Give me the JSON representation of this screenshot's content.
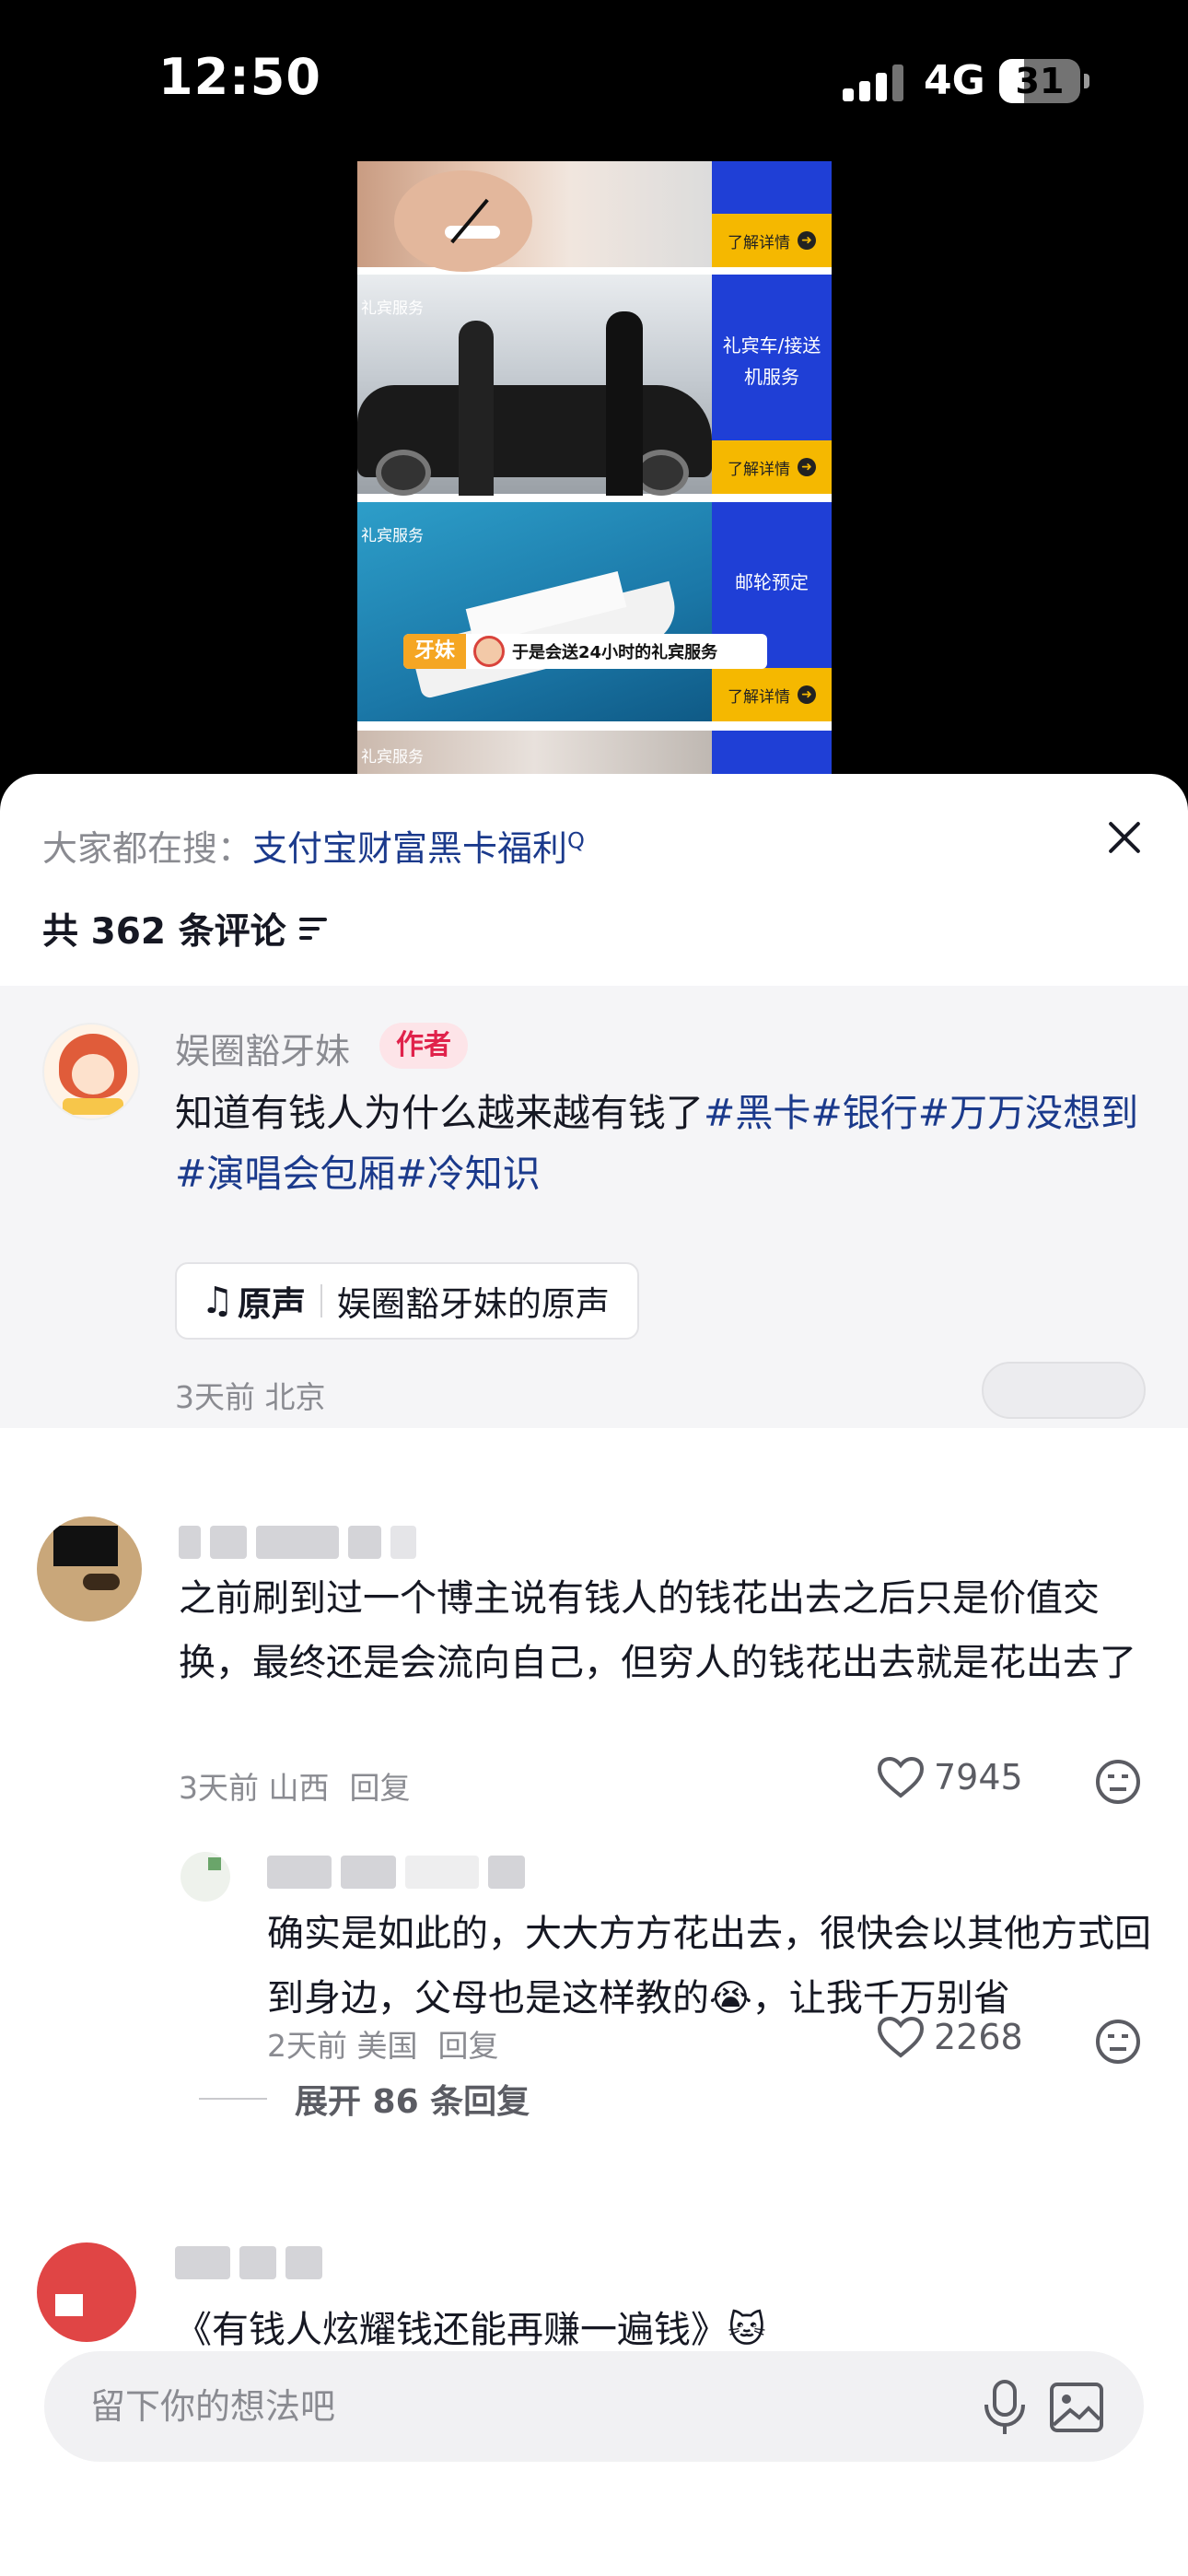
{
  "status_bar": {
    "time": "12:50",
    "network": "4G",
    "battery": "31",
    "battery_level": 0.31
  },
  "video": {
    "rows": [
      {
        "tag": "",
        "side_label": "",
        "button": "了解详情"
      },
      {
        "tag": "礼宾服务",
        "side_label": "礼宾车/接送机服务",
        "button": "了解详情"
      },
      {
        "tag": "礼宾服务",
        "side_label": "邮轮预定",
        "button": "了解详情"
      },
      {
        "tag": "礼宾服务",
        "side_label": "",
        "button": ""
      }
    ],
    "banner_brand": "牙妹",
    "banner_text": "于是会送24小时的礼宾服务",
    "arrow": "➜"
  },
  "sheet": {
    "search_prefix": "大家都在搜：",
    "search_term": "支付宝财富黑卡福利",
    "search_mark": "Q",
    "comment_count": "共 362 条评论"
  },
  "author_post": {
    "name": "娱圈豁牙妹",
    "badge": "作者",
    "text": "知道有钱人为什么越来越有钱了",
    "hashtags": [
      "#黑卡",
      "#银行",
      "#万万没想到",
      "#演唱会包厢",
      "#冷知识"
    ],
    "music_label": "原声",
    "music_title": "娱圈豁牙妹的原声",
    "meta": "3天前 北京",
    "note_glyph": "♫"
  },
  "comments": [
    {
      "text": "之前刷到过一个博主说有钱人的钱花出去之后只是价值交换，最终还是会流向自己，但穷人的钱花出去就是花出去了",
      "meta": "3天前 山西",
      "reply": "回复",
      "likes": "7945"
    },
    {
      "text": "确实是如此的，大大方方花出去，很快会以其他方式回到身边，父母也是这样教的😭，让我千万别省",
      "meta": "2天前 美国",
      "reply": "回复",
      "likes": "2268"
    },
    {
      "text": "《有钱人炫耀钱还能再赚一遍钱》🐱"
    }
  ],
  "expand_label": "展开 86 条回复",
  "input": {
    "placeholder": "留下你的想法吧"
  }
}
